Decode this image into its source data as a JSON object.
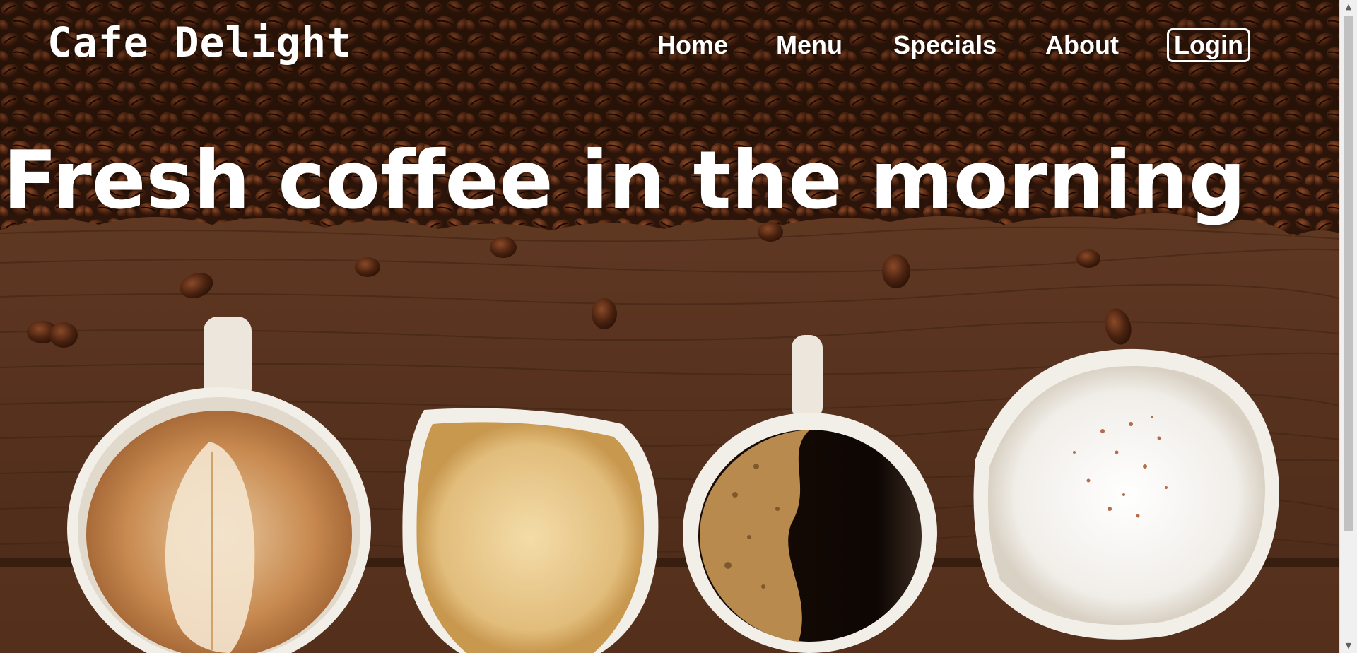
{
  "site": {
    "brand": "Cafe Delight"
  },
  "nav": {
    "items": [
      {
        "label": "Home"
      },
      {
        "label": "Menu"
      },
      {
        "label": "Specials"
      },
      {
        "label": "About"
      }
    ],
    "login_label": "Login"
  },
  "hero": {
    "headline": "Fresh coffee in the morning",
    "background_description_icon": "coffee-beans-and-cups-photo"
  },
  "colors": {
    "text": "#ffffff",
    "wood": "#5a3520",
    "bean": "#3b1c0e",
    "scrollbar_track": "#f0f0f0",
    "scrollbar_thumb": "#c1c1c1"
  }
}
